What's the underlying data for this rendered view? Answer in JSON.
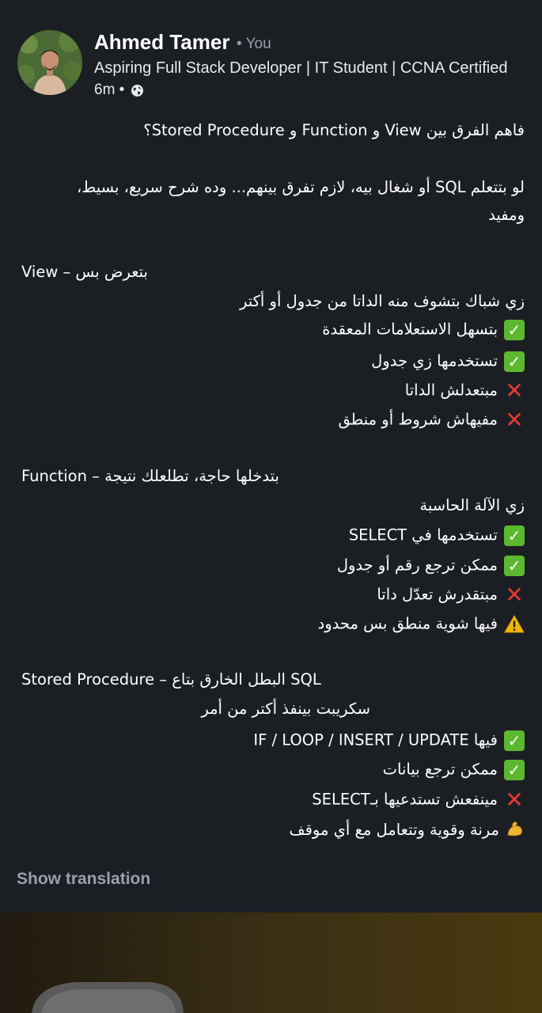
{
  "author": {
    "name": "Ahmed Tamer",
    "you_tag": "• You",
    "headline": "Aspiring Full Stack Developer | IT Student | CCNA Certified",
    "time": "6m •",
    "visibility_icon": "globe-icon"
  },
  "post": {
    "title": "فاهم الفرق بين View و Function و Stored Procedure؟",
    "intro_line1": "لو بتتعلم SQL أو شغال بيه، لازم تفرق بينهم... وده شرح سريع، بسيط،",
    "intro_line2": "ومفيد",
    "view": {
      "heading": "View – بتعرض بس",
      "desc": "زي شباك بتشوف منه الداتا من جدول أو أكتر",
      "items": [
        {
          "icon": "check-mark-icon",
          "text": "بتسهل الاستعلامات المعقدة"
        },
        {
          "icon": "check-mark-icon",
          "text": "تستخدمها زي جدول"
        },
        {
          "icon": "cross-mark-icon",
          "text": "مبتعدلش الداتا"
        },
        {
          "icon": "cross-mark-icon",
          "text": "مفيهاش شروط أو منطق"
        }
      ]
    },
    "function": {
      "heading": "Function – بتدخلها حاجة، تطلعلك نتيجة",
      "desc": "زي الآلة الحاسبة",
      "items": [
        {
          "icon": "check-mark-icon",
          "text": "تستخدمها في SELECT"
        },
        {
          "icon": "check-mark-icon",
          "text": "ممكن ترجع رقم أو جدول"
        },
        {
          "icon": "cross-mark-icon",
          "text": "مبتقدرش تعدّل داتا"
        },
        {
          "icon": "warning-icon",
          "text": "فيها شوية منطق بس محدود"
        }
      ]
    },
    "procedure": {
      "heading": "Stored Procedure – البطل الخارق بتاع SQL",
      "desc": "سكريبت بينفذ أكتر من أمر",
      "items": [
        {
          "icon": "check-mark-icon",
          "text": "فيها IF / LOOP / INSERT / UPDATE"
        },
        {
          "icon": "check-mark-icon",
          "text": "ممكن ترجع بيانات"
        },
        {
          "icon": "cross-mark-icon",
          "text": "مينفعش تستدعيها بـSELECT"
        },
        {
          "icon": "flexed-biceps-icon",
          "text": "مرنة وقوية وتتعامل مع أي موقف"
        }
      ]
    }
  },
  "actions": {
    "show_translation": "Show translation"
  },
  "colors": {
    "background": "#1b1f23",
    "text": "#ffffff",
    "muted": "#9aa0a6",
    "check": "#5cb82e",
    "cross": "#e53935"
  }
}
